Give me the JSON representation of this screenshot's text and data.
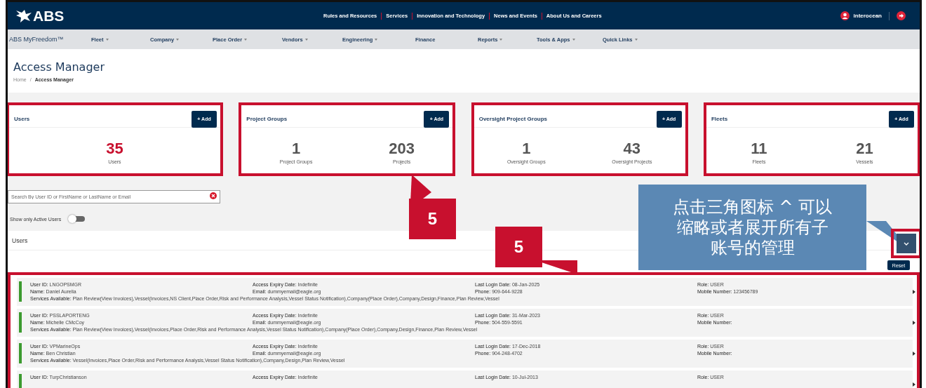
{
  "topbar": {
    "logo": "ABS",
    "links": [
      "Rules and Resources",
      "Services",
      "Innovation and Technology",
      "News and Events",
      "About Us and Careers"
    ],
    "user": "interocean"
  },
  "navbar": {
    "brand": "ABS MyFreedom™",
    "items": [
      {
        "label": "Fleet",
        "dropdown": true
      },
      {
        "label": "Company",
        "dropdown": true
      },
      {
        "label": "Place Order",
        "dropdown": true
      },
      {
        "label": "Vendors",
        "dropdown": true
      },
      {
        "label": "Engineering",
        "dropdown": true
      },
      {
        "label": "Finance",
        "dropdown": false
      },
      {
        "label": "Reports",
        "dropdown": true
      },
      {
        "label": "Tools & Apps",
        "dropdown": true
      },
      {
        "label": "Quick Links",
        "dropdown": true
      }
    ]
  },
  "page": {
    "title": "Access Manager",
    "breadcrumb_separator": "/",
    "breadcrumb": [
      "Home",
      "Access Manager"
    ]
  },
  "cards": [
    {
      "title": "Users",
      "add_button": "+ Add",
      "highlighted": true,
      "stats": [
        {
          "value": "35",
          "label": "Users",
          "color": "#c8102e"
        }
      ]
    },
    {
      "title": "Project Groups",
      "add_button": "+ Add",
      "highlighted": true,
      "stats": [
        {
          "value": "1",
          "label": "Project Groups",
          "color": "#555555"
        },
        {
          "value": "203",
          "label": "Projects",
          "color": "#555555"
        }
      ]
    },
    {
      "title": "Oversight Project Groups",
      "add_button": "+ Add",
      "highlighted": true,
      "stats": [
        {
          "value": "1",
          "label": "Oversight Groups",
          "color": "#555555"
        },
        {
          "value": "43",
          "label": "Oversight Projects",
          "color": "#555555"
        }
      ]
    },
    {
      "title": "Fleets",
      "add_button": "+ Add",
      "highlighted": true,
      "stats": [
        {
          "value": "11",
          "label": "Fleets",
          "color": "#555555"
        },
        {
          "value": "21",
          "label": "Vessels",
          "color": "#555555"
        }
      ]
    }
  ],
  "search": {
    "placeholder": "Search By User ID or FirstName or LastName or Email"
  },
  "active_toggle": {
    "label": "Show only Active Users",
    "on": false
  },
  "users_panel": {
    "title": "Users",
    "collapse_highlighted": true,
    "reset_button": "Reset",
    "list_highlighted": true,
    "rows": [
      {
        "columns": [
          [
            {
              "label": "User ID:",
              "value": "LNGOPSMGR"
            },
            {
              "label": "Name:",
              "value": "Daniel Aurelia"
            }
          ],
          [
            {
              "label": "Access Expiry Date:",
              "value": "Indefinite"
            },
            {
              "label": "Email:",
              "value": "dummyemail@eagle.org"
            }
          ],
          [
            {
              "label": "Last Login Date:",
              "value": "08-Jan-2025"
            },
            {
              "label": "Phone:",
              "value": "909-644-9228"
            }
          ],
          [
            {
              "label": "Role:",
              "value": "USER"
            },
            {
              "label": "Mobile Number:",
              "value": "123456789"
            }
          ]
        ],
        "services": {
          "label": "Services Available:",
          "value": "Plan Review(View Invoices),Vessel(Invoices,NS Client,Place Order,Risk and Performance Analysis,Vessel Status Notification),Company(Place Order),Company,Design,Finance,Plan Review,Vessel"
        }
      },
      {
        "columns": [
          [
            {
              "label": "User ID:",
              "value": "PSSLAPORTENG"
            },
            {
              "label": "Name:",
              "value": "Michelle CMcCoy"
            }
          ],
          [
            {
              "label": "Access Expiry Date:",
              "value": "Indefinite"
            },
            {
              "label": "Email:",
              "value": "dummyemail@eagle.org"
            }
          ],
          [
            {
              "label": "Last Login Date:",
              "value": "31-Mar-2023"
            },
            {
              "label": "Phone:",
              "value": "504-559-5591"
            }
          ],
          [
            {
              "label": "Role:",
              "value": "USER"
            },
            {
              "label": "Mobile Number:"
            }
          ]
        ],
        "services": {
          "label": "Services Available:",
          "value": "Plan Review(View Invoices),Vessel(Invoices,Place Order,Risk and Performance Analysis,Vessel Status Notification),Company(Place Order),Company,Design,Finance,Plan Review,Vessel"
        }
      },
      {
        "columns": [
          [
            {
              "label": "User ID:",
              "value": "VPMarineOps"
            },
            {
              "label": "Name:",
              "value": "Ben Christian"
            }
          ],
          [
            {
              "label": "Access Expiry Date:",
              "value": "Indefinite"
            },
            {
              "label": "Email:",
              "value": "dummyemail@eagle.org"
            }
          ],
          [
            {
              "label": "Last Login Date:",
              "value": "17-Dec-2018"
            },
            {
              "label": "Phone:",
              "value": "904-248-4702"
            }
          ],
          [
            {
              "label": "Role:",
              "value": "USER"
            },
            {
              "label": "Mobile Number:"
            }
          ]
        ],
        "services": {
          "label": "Services Available:",
          "value": "Vessel(Invoices,Place Order,Risk and Performance Analysis,Vessel Status Notification),Company,Design,Plan Review,Vessel"
        }
      },
      {
        "columns": [
          [
            {
              "label": "User ID:",
              "value": "TurpChristianson"
            }
          ],
          [
            {
              "label": "Access Expiry Date:",
              "value": "Indefinite"
            }
          ],
          [
            {
              "label": "Last Login Date:",
              "value": "10-Jul-2013"
            }
          ],
          [
            {
              "label": "Role:",
              "value": "USER"
            }
          ]
        ]
      }
    ]
  },
  "annotations": [
    {
      "kind": "number",
      "text": "5"
    },
    {
      "kind": "number",
      "text": "5"
    },
    {
      "kind": "callout",
      "text": "点击三角图标 ^ 可以缩略或者展开所有子账号的管理"
    }
  ]
}
